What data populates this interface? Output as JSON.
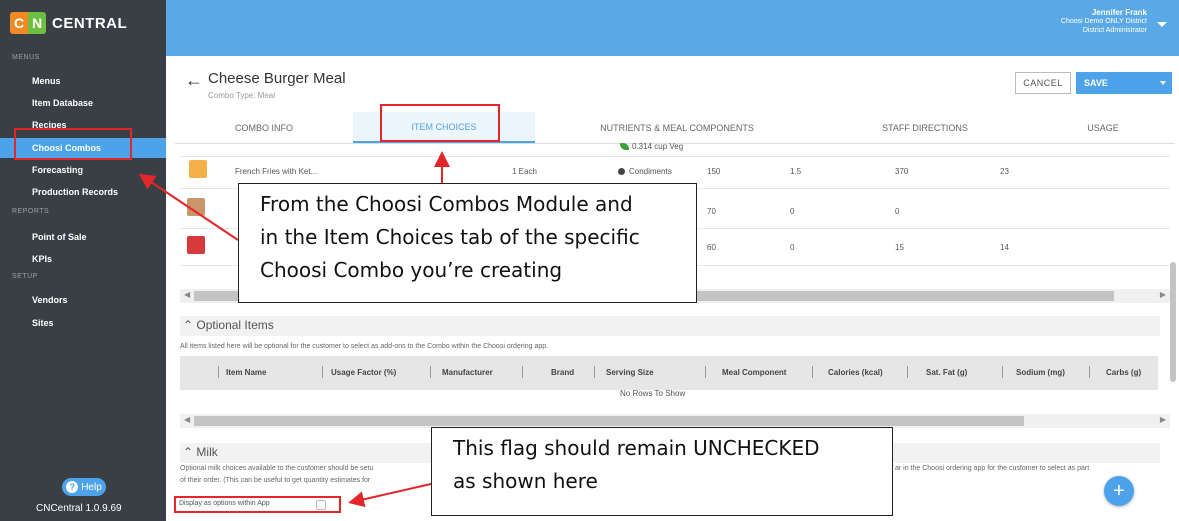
{
  "sidebar": {
    "logo_c": "C",
    "logo_n": "N",
    "logo_text": "CENTRAL",
    "sections": [
      "MENUS",
      "REPORTS",
      "SETUP"
    ],
    "items": [
      {
        "label": "Menus"
      },
      {
        "label": "Item Database"
      },
      {
        "label": "Recipes"
      },
      {
        "label": "Choosi Combos",
        "active": true
      },
      {
        "label": "Forecasting"
      },
      {
        "label": "Production Records"
      },
      {
        "label": "Point of Sale"
      },
      {
        "label": "KPIs"
      },
      {
        "label": "Vendors"
      },
      {
        "label": "Sites"
      }
    ],
    "help_label": "Help",
    "version": "CNCentral 1.0.9.69"
  },
  "user": {
    "name": "Jennifer Frank",
    "district": "Choosi Demo ONLY District",
    "role": "District Administrator"
  },
  "header": {
    "title": "Cheese Burger Meal",
    "subtitle": "Combo Type: Meal",
    "cancel_label": "CANCEL",
    "save_label": "SAVE"
  },
  "tabs": [
    {
      "label": "COMBO INFO"
    },
    {
      "label": "ITEM CHOICES",
      "active": true
    },
    {
      "label": "NUTRIENTS & MEAL COMPONENTS"
    },
    {
      "label": "STAFF DIRECTIONS"
    },
    {
      "label": "USAGE"
    }
  ],
  "items_table": {
    "veg_note": "0.314 cup Veg",
    "rows": [
      {
        "name": "French Fries with Ket...",
        "usage": "1 Each",
        "component": "Condiments",
        "v1": "150",
        "v2": "1.5",
        "v3": "370",
        "v4": "23"
      },
      {
        "name": "",
        "usage": "",
        "component": "",
        "v1": "70",
        "v2": "0",
        "v3": "0",
        "v4": ""
      },
      {
        "name": "",
        "usage": "",
        "component": "",
        "v1": "60",
        "v2": "0",
        "v3": "15",
        "v4": "14"
      }
    ]
  },
  "optional_items": {
    "title": "Optional Items",
    "description": "All items listed here will be optional for the customer to select as add-ons to the Combo within the Choosi ordering app.",
    "columns": [
      "Item Name",
      "Usage Factor (%)",
      "Manufacturer",
      "Brand",
      "Serving Size",
      "Meal Component",
      "Calories (kcal)",
      "Sat. Fat (g)",
      "Sodium (mg)",
      "Carbs (g)"
    ],
    "empty_text": "No Rows To Show"
  },
  "milk": {
    "title": "Milk",
    "desc_line1_left": "Optional milk choices available to the customer should be setu",
    "desc_line1_right": "ar in the Choosi ordering app for the customer to select as part",
    "desc_line2": "of their order. (This can be useful to get quantity estimates for",
    "display_label": "Display as options within App",
    "display_checked": false
  },
  "annotations": {
    "callout1": [
      "From the Choosi Combos Module and",
      "in the Item Choices tab of the specific",
      "Choosi Combo you’re creating"
    ],
    "callout2": [
      "This flag should remain UNCHECKED",
      "as shown here"
    ]
  },
  "colors": {
    "accent": "#4da3ea",
    "topbar": "#5aa9e6",
    "sidebar": "#3a3f45",
    "annotation_red": "#e2262a"
  }
}
